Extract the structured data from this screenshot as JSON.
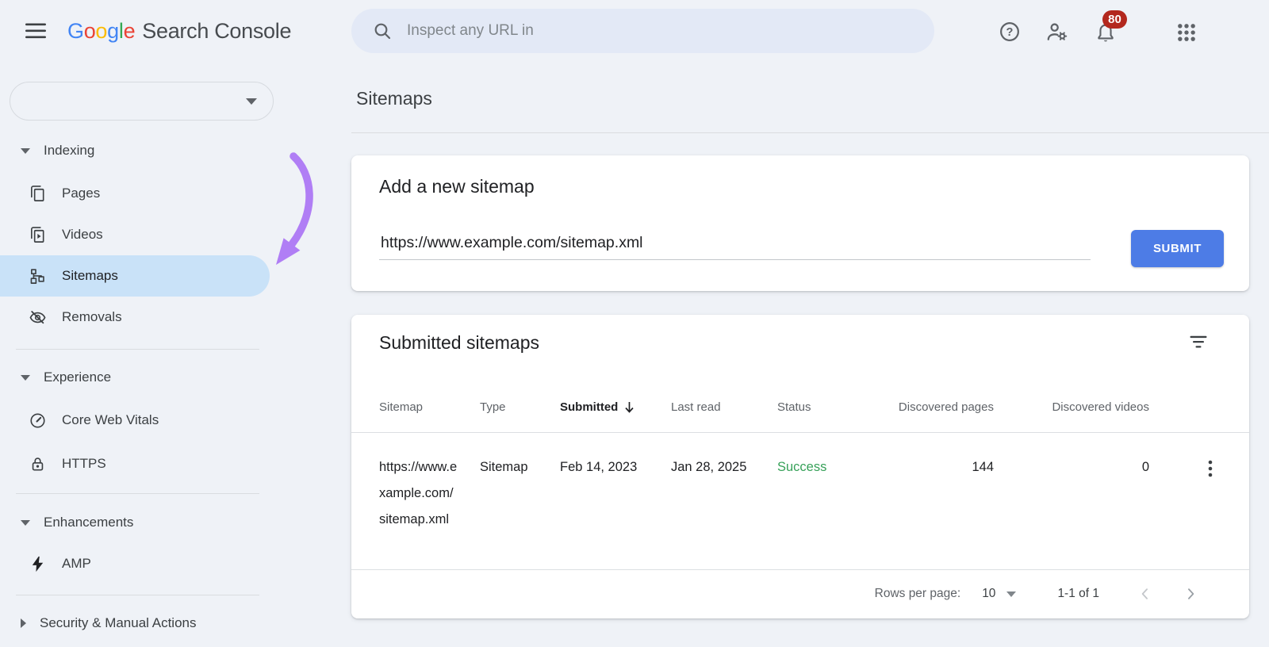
{
  "header": {
    "brand": {
      "letters": [
        "G",
        "o",
        "o",
        "g",
        "l",
        "e"
      ],
      "colors": [
        "#4285F4",
        "#EA4335",
        "#FBBC05",
        "#4285F4",
        "#34A853",
        "#EA4335"
      ]
    },
    "app_name": "Search Console",
    "search_placeholder": "Inspect any URL in",
    "notification_count": "80"
  },
  "sidebar": {
    "property_selector": {
      "value": ""
    },
    "sections": [
      {
        "label": "Indexing",
        "expanded": true,
        "items": [
          {
            "label": "Pages",
            "icon": "pages-icon"
          },
          {
            "label": "Videos",
            "icon": "videos-icon"
          },
          {
            "label": "Sitemaps",
            "icon": "sitemaps-icon",
            "selected": true
          },
          {
            "label": "Removals",
            "icon": "removals-icon"
          }
        ]
      },
      {
        "label": "Experience",
        "expanded": true,
        "items": [
          {
            "label": "Core Web Vitals",
            "icon": "core-web-vitals-icon"
          },
          {
            "label": "HTTPS",
            "icon": "https-icon"
          }
        ]
      },
      {
        "label": "Enhancements",
        "expanded": true,
        "items": [
          {
            "label": "AMP",
            "icon": "amp-icon"
          }
        ]
      },
      {
        "label": "Security & Manual Actions",
        "expanded": false,
        "items": []
      }
    ]
  },
  "main": {
    "page_title": "Sitemaps",
    "add_sitemap_card": {
      "title": "Add a new sitemap",
      "input_value": "https://www.example.com/sitemap.xml",
      "submit_label": "SUBMIT"
    },
    "submitted_card": {
      "title": "Submitted sitemaps",
      "columns": [
        "Sitemap",
        "Type",
        "Submitted",
        "Last read",
        "Status",
        "Discovered pages",
        "Discovered videos"
      ],
      "sort_column": "Submitted",
      "sort_direction": "desc",
      "rows": [
        {
          "sitemap": "https://www.example.com/sitemap.xml",
          "type": "Sitemap",
          "submitted": "Feb 14, 2023",
          "last_read": "Jan 28, 2025",
          "status": "Success",
          "discovered_pages": "144",
          "discovered_videos": "0"
        }
      ],
      "footer": {
        "rows_per_page_label": "Rows per page:",
        "rows_per_page_value": "10",
        "range_label": "1-1 of 1"
      }
    }
  },
  "colors": {
    "accent_blue": "#4d7ce6",
    "selected_item_bg": "#c9e2f8",
    "success_green": "#37a159",
    "arrow_purple": "#b07ef5",
    "badge_red": "#b3281e",
    "search_pill_bg": "#e3e9f6",
    "page_bg": "#eff2f7"
  }
}
